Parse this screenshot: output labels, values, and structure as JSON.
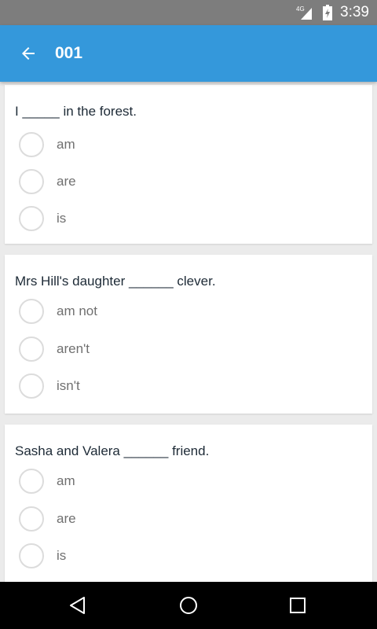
{
  "status_bar": {
    "network": "4G",
    "time": "3:39"
  },
  "app_bar": {
    "back_icon": "arrow-back-icon",
    "title": "001"
  },
  "questions": [
    {
      "text": "I _____ in the forest.",
      "options": [
        "am",
        "are",
        "is"
      ]
    },
    {
      "text": "Mrs Hill's daughter ______ clever.",
      "options": [
        "am not",
        "aren't",
        "isn't"
      ]
    },
    {
      "text": "Sasha and Valera ______ friend.",
      "options": [
        "am",
        "are",
        "is"
      ]
    }
  ],
  "nav_bar": {
    "back_icon": "nav-back-icon",
    "home_icon": "nav-home-icon",
    "recents_icon": "nav-recents-icon"
  },
  "colors": {
    "app_bar": "#3498db",
    "status_bar": "#7d7d7d",
    "background": "#ebebeb"
  }
}
